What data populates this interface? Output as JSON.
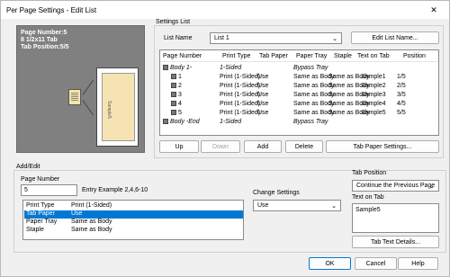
{
  "window": {
    "title": "Per Page Settings - Edit List",
    "close_glyph": "✕"
  },
  "preview": {
    "line1": "Page Number:5",
    "line2": "8 1/2x11 Tab",
    "line3": "Tab Position:5/5",
    "tab_label": "Sample5"
  },
  "settings_list": {
    "group_label": "Settings List",
    "list_name_label": "List Name",
    "list_name_value": "List 1",
    "edit_list_name_button": "Edit List Name...",
    "columns": [
      "Page Number",
      "Print Type",
      "Tab Paper",
      "Paper Tray",
      "Staple",
      "Text on Tab",
      "Position"
    ],
    "rows": [
      {
        "page": "Body 1-",
        "print_type": "1-Sided",
        "tab_paper": "",
        "paper_tray": "Bypass Tray",
        "staple": "",
        "text": "",
        "position": ""
      },
      {
        "page": "1",
        "print_type": "Print (1-Sided)",
        "tab_paper": "Use",
        "paper_tray": "Same as Body",
        "staple": "Same as Body",
        "text": "Sample1",
        "position": "1/5"
      },
      {
        "page": "2",
        "print_type": "Print (1-Sided)",
        "tab_paper": "Use",
        "paper_tray": "Same as Body",
        "staple": "Same as Body",
        "text": "Sample2",
        "position": "2/5"
      },
      {
        "page": "3",
        "print_type": "Print (1-Sided)",
        "tab_paper": "Use",
        "paper_tray": "Same as Body",
        "staple": "Same as Body",
        "text": "Sample3",
        "position": "3/5"
      },
      {
        "page": "4",
        "print_type": "Print (1-Sided)",
        "tab_paper": "Use",
        "paper_tray": "Same as Body",
        "staple": "Same as Body",
        "text": "Sample4",
        "position": "4/5"
      },
      {
        "page": "5",
        "print_type": "Print (1-Sided)",
        "tab_paper": "Use",
        "paper_tray": "Same as Body",
        "staple": "Same as Body",
        "text": "Sample5",
        "position": "5/5"
      },
      {
        "page": "Body -End",
        "print_type": "1-Sided",
        "tab_paper": "",
        "paper_tray": "Bypass Tray",
        "staple": "",
        "text": "",
        "position": ""
      }
    ],
    "buttons": {
      "up": "Up",
      "down": "Down",
      "add": "Add",
      "delete": "Delete",
      "tab_paper_settings": "Tab Paper Settings..."
    }
  },
  "add_edit": {
    "group_label": "Add/Edit",
    "page_number_label": "Page Number",
    "page_number_value": "5",
    "entry_example": "Entry Example 2,4,6-10",
    "properties": [
      {
        "name": "Print Type",
        "value": "Print (1-Sided)"
      },
      {
        "name": "Tab Paper",
        "value": "Use"
      },
      {
        "name": "Paper Tray",
        "value": "Same as Body"
      },
      {
        "name": "Staple",
        "value": "Same as Body"
      }
    ],
    "change_settings_label": "Change Settings",
    "change_settings_value": "Use",
    "tab_position_label": "Tab Position",
    "tab_position_value": "Continue the Previous Page",
    "text_on_tab_label": "Text on Tab",
    "text_on_tab_value": "Sample5",
    "tab_text_details_button": "Tab Text Details..."
  },
  "footer": {
    "ok": "OK",
    "cancel": "Cancel",
    "help": "Help"
  }
}
